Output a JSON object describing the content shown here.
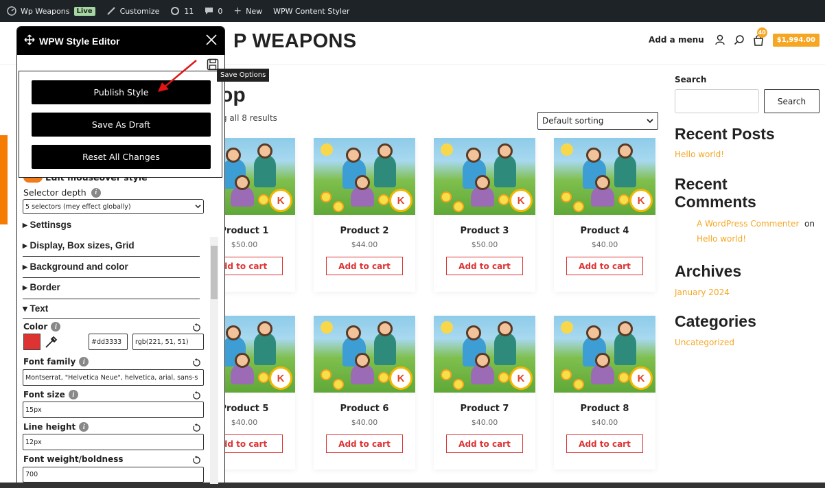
{
  "adminbar": {
    "site_name": "Wp Weapons",
    "live": "Live",
    "customize": "Customize",
    "updates": "11",
    "comments": "0",
    "new": "New",
    "plugin": "WPW Content Styler"
  },
  "header": {
    "title": "P WEAPONS",
    "add_menu": "Add a menu",
    "cart_count": "40",
    "cart_total": "$1,994.00"
  },
  "shop": {
    "title": "op",
    "result_count": "g all 8 results",
    "sorting": "Default sorting",
    "add_to_cart": "Add to cart",
    "products": [
      {
        "name": "Product 1",
        "price": "$50.00",
        "button": "dd to cart"
      },
      {
        "name": "Product 2",
        "price": "$44.00",
        "button": "Add to cart"
      },
      {
        "name": "Product 3",
        "price": "$50.00",
        "button": "Add to cart"
      },
      {
        "name": "Product 4",
        "price": "$40.00",
        "button": "Add to cart"
      },
      {
        "name": "Product 5",
        "price": "$40.00",
        "button": "dd to cart"
      },
      {
        "name": "Product 6",
        "price": "$40.00",
        "button": "Add to cart"
      },
      {
        "name": "Product 7",
        "price": "$40.00",
        "button": "Add to cart"
      },
      {
        "name": "Product 8",
        "price": "$40.00",
        "button": "Add to cart"
      }
    ]
  },
  "sidebar": {
    "search_label": "Search",
    "search_button": "Search",
    "recent_posts": "Recent Posts",
    "post_1": "Hello world!",
    "recent_comments_1": "Recent",
    "recent_comments_2": "Comments",
    "commenter": "A WordPress Commenter",
    "on": "on",
    "comment_post": "Hello world!",
    "archives": "Archives",
    "archive_1": "January 2024",
    "categories": "Categories",
    "category_1": "Uncategorized"
  },
  "editor": {
    "title": "WPW Style Editor",
    "tooltip": "Save Options",
    "publish": "Publish Style",
    "draft": "Save As Draft",
    "reset": "Reset All Changes",
    "mouseover": "Edit mouseover style",
    "selector_depth": "Selector depth",
    "selector_value": "5 selectors (mey effect globally)",
    "sections": {
      "settings": "▸ Settinsgs",
      "display": "▸ Display, Box sizes, Grid",
      "background": "▸ Background and color",
      "border": "▸ Border",
      "text": "▾ Text"
    },
    "color_label": "Color",
    "color_hex": "#dd3333",
    "color_rgb": "rgb(221, 51, 51)",
    "font_family_label": "Font family",
    "font_family_value": "Montserrat, \"Helvetica Neue\", helvetica, arial, sans-s",
    "font_size_label": "Font size",
    "font_size_value": "15px",
    "line_height_label": "Line height",
    "line_height_value": "12px",
    "font_weight_label": "Font weight/boldness",
    "font_weight_value": "700"
  },
  "colors": {
    "accent": "#f5a623",
    "red": "#dd3333",
    "dark": "#000000"
  }
}
